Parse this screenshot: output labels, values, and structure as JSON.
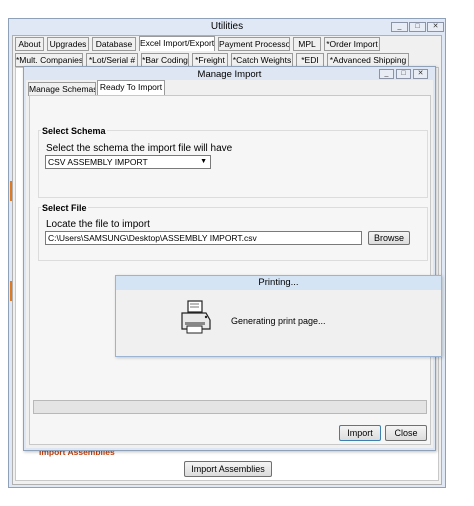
{
  "utilities": {
    "title": "Utilities",
    "tabs_row1": [
      "About",
      "Upgrades",
      "Database",
      "Excel Import/Export",
      "Payment Processor",
      "MPL",
      "*Order Import"
    ],
    "tabs_row2": [
      "*Mult. Companies",
      "*Lot/Serial #",
      "*Bar Coding",
      "*Freight",
      "*Catch Weights",
      "*EDI",
      "*Advanced Shipping"
    ],
    "import_assemblies_label": "Import Assemblies",
    "import_assemblies_button": "Import Assemblies"
  },
  "manage_import": {
    "title": "Manage Import",
    "tabs": [
      "Manage Schemas",
      "Ready To Import"
    ],
    "select_schema": {
      "heading": "Select Schema",
      "prompt": "Select the schema the import file will have",
      "selected": "CSV ASSEMBLY IMPORT"
    },
    "select_file": {
      "heading": "Select File",
      "prompt": "Locate the file to import",
      "path": "C:\\Users\\SAMSUNG\\Desktop\\ASSEMBLY IMPORT.csv",
      "browse_button": "Browse"
    },
    "import_button": "Import",
    "close_button": "Close"
  },
  "printing": {
    "title": "Printing...",
    "message": "Generating print page..."
  },
  "window_buttons": {
    "minimize": "_",
    "maximize": "□",
    "close": "✕"
  }
}
